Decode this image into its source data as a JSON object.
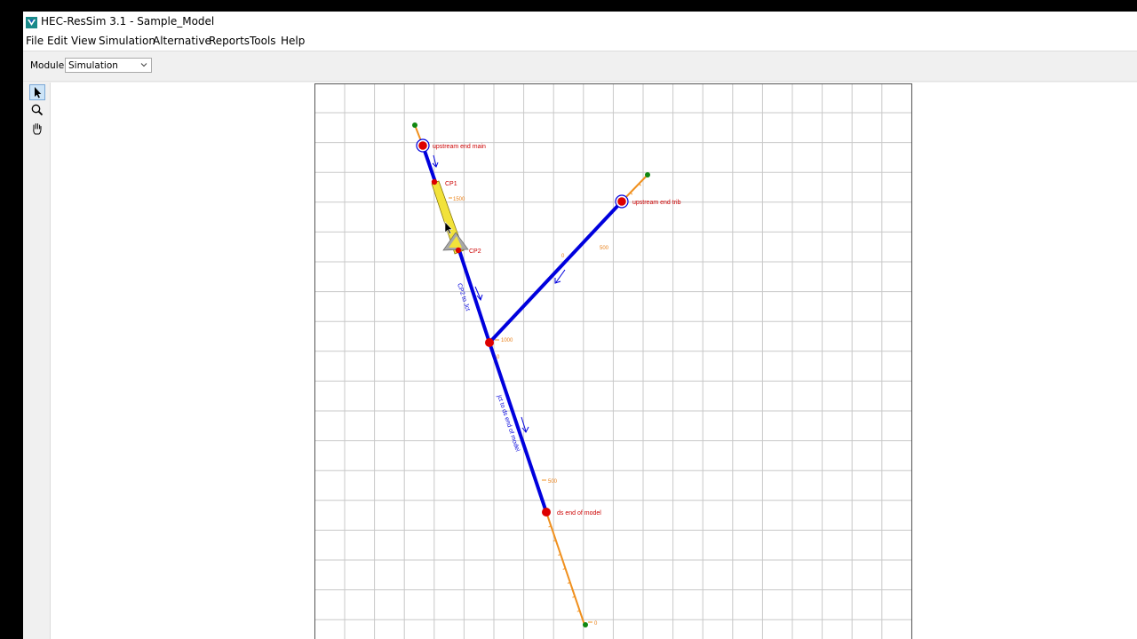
{
  "window": {
    "title": "HEC-ResSim 3.1  - Sample_Model"
  },
  "menu": [
    "File",
    "Edit",
    "View",
    "Simulation",
    "Alternative",
    "Reports",
    "Tools",
    "Help"
  ],
  "module": {
    "label": "Module:",
    "value": "Simulation"
  },
  "tools": [
    {
      "name": "select",
      "icon": "arrow-pointer-icon",
      "active": true
    },
    {
      "name": "zoom",
      "icon": "magnifier-icon",
      "active": false
    },
    {
      "name": "pan",
      "icon": "hand-icon",
      "active": false
    }
  ],
  "colors": {
    "reach": "#0000dd",
    "extension": "#f0901e",
    "label": "#cc0000",
    "station": "#e8801a",
    "node": "#dd0000",
    "endpoint": "#118811",
    "reservoir": "#f2e23a",
    "grid": "#c8c8c8"
  },
  "map": {
    "nodes": {
      "upstream_main": "upstream end main",
      "cp1": "CP1",
      "cp2": "CP2",
      "upstream_trib": "upstream end trib",
      "ds_end": "ds end of model"
    },
    "reaches": {
      "cp2_to_jct": "CP2 to Jct",
      "jct_to_ds": "jct to ds end of model"
    },
    "stations": {
      "main_1500": "1500",
      "trib_500": "500",
      "trib_0": "0",
      "jct_1000": "1000",
      "jct_0": "0",
      "ds_500": "500",
      "ds_0": "0"
    }
  }
}
